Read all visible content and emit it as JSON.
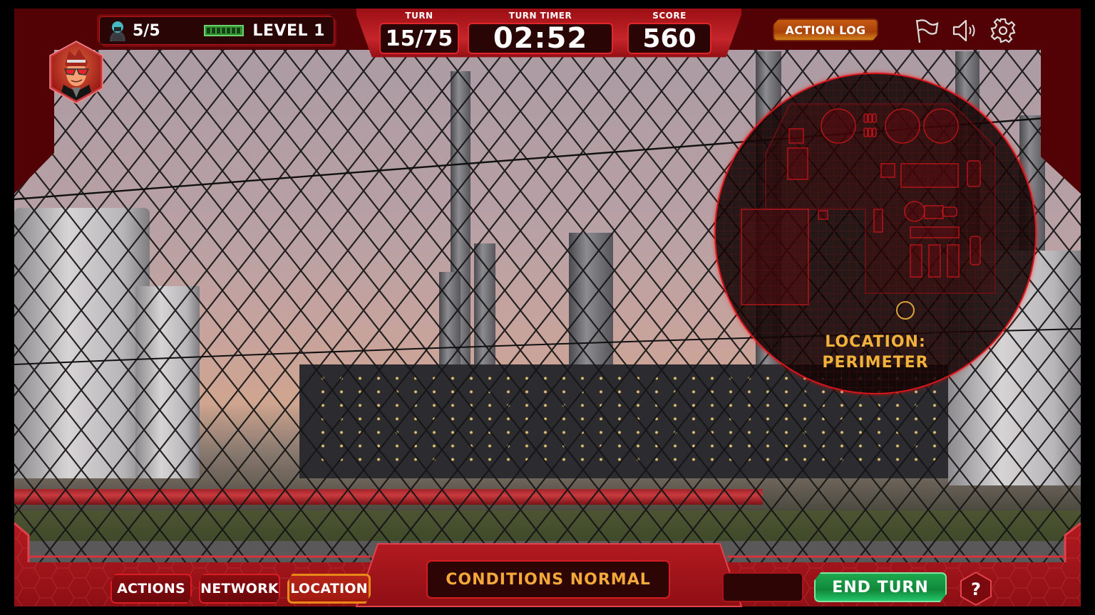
{
  "header": {
    "agents_count": "5/5",
    "level": "LEVEL 1",
    "turn_label": "TURN",
    "turn_value": "15/75",
    "timer_label": "TURN TIMER",
    "timer_value": "02:52",
    "score_label": "SCORE",
    "score_value": "560",
    "action_log_label": "ACTION LOG",
    "icons": [
      "flag-icon",
      "speaker-icon",
      "gear-icon"
    ]
  },
  "player": {
    "avatar": "hacker-avatar-red-sunglasses"
  },
  "location_map": {
    "title_line1": "LOCATION:",
    "title_line2": "PERIMETER"
  },
  "footer": {
    "tabs": [
      {
        "label": "ACTIONS",
        "active": false
      },
      {
        "label": "NETWORK",
        "active": false
      },
      {
        "label": "LOCATION",
        "active": true
      }
    ],
    "status_message": "CONDITIONS NORMAL",
    "end_turn_label": "END TURN",
    "help_label": "?"
  },
  "colors": {
    "frame": "#520205",
    "hud_red": "#c4252a",
    "accent_orange": "#e88a18",
    "status_text": "#f3a93a",
    "end_turn_green": "#1ea84d",
    "map_outline": "#d8151b"
  }
}
